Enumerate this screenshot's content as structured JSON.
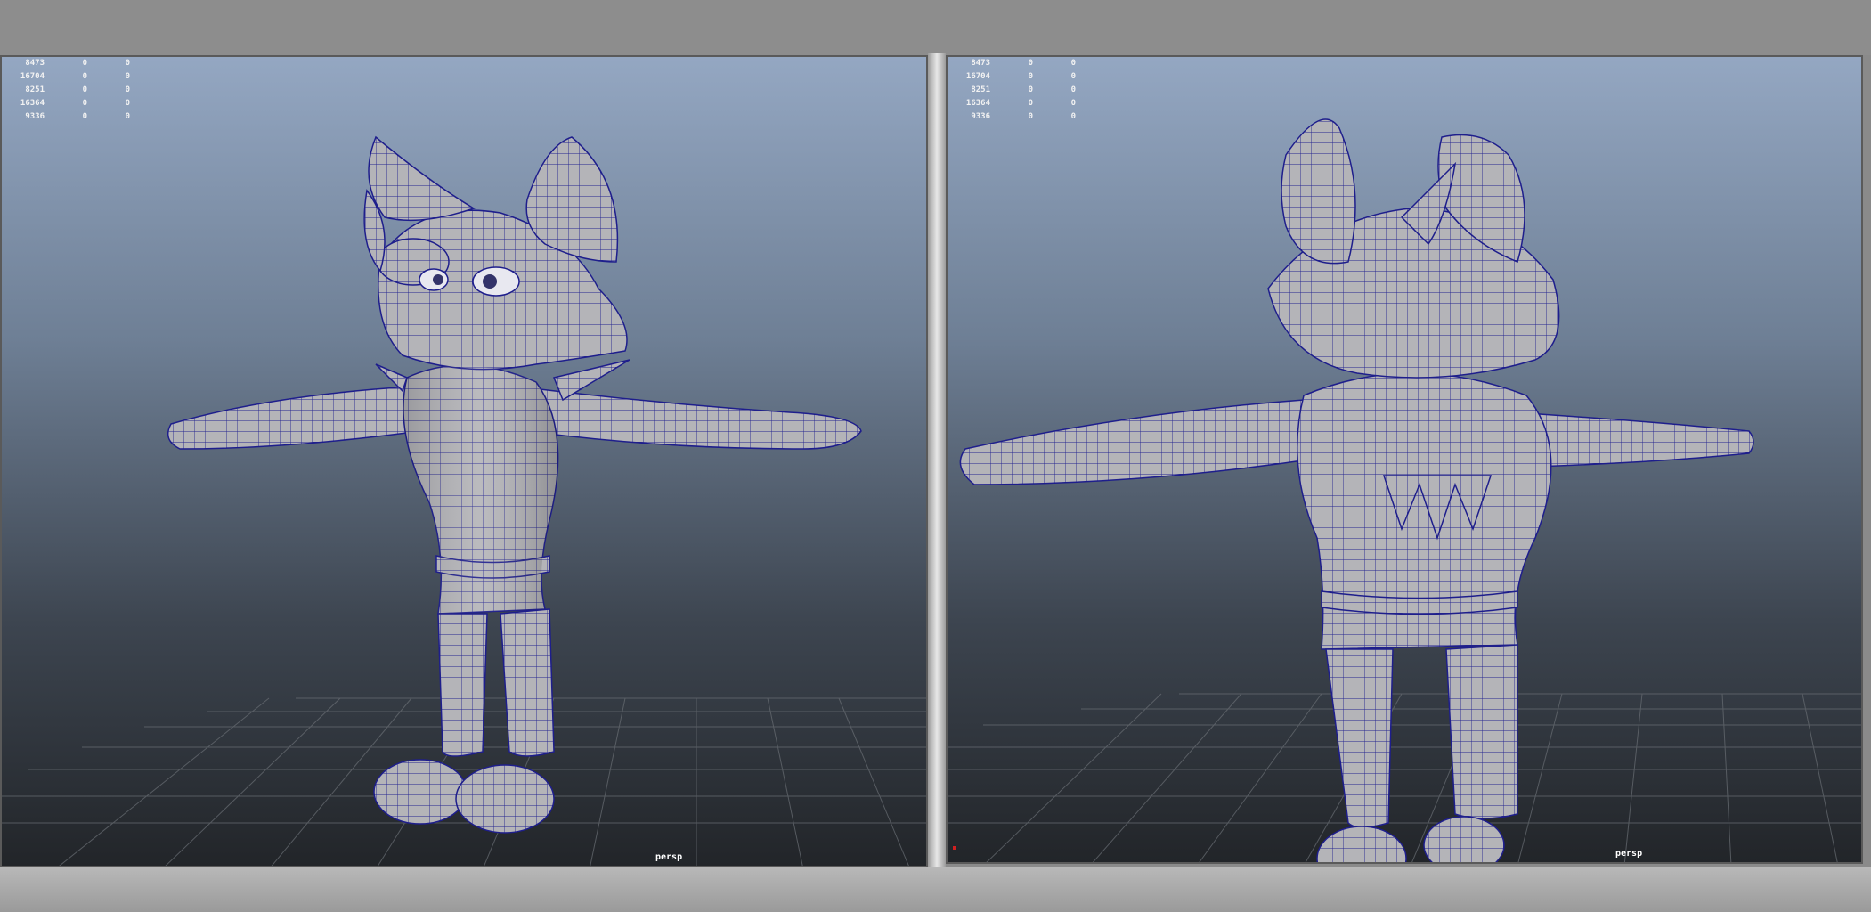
{
  "viewports": {
    "left": {
      "hud_rows": [
        [
          "8473",
          "0",
          "0"
        ],
        [
          "16704",
          "0",
          "0"
        ],
        [
          "8251",
          "0",
          "0"
        ],
        [
          "16364",
          "0",
          "0"
        ],
        [
          "9336",
          "0",
          "0"
        ]
      ],
      "camera_label": "persp"
    },
    "right": {
      "hud_rows": [
        [
          "8473",
          "0",
          "0"
        ],
        [
          "16704",
          "0",
          "0"
        ],
        [
          "8251",
          "0",
          "0"
        ],
        [
          "16364",
          "0",
          "0"
        ],
        [
          "9336",
          "0",
          "0"
        ]
      ],
      "camera_label": "persp"
    }
  },
  "colors": {
    "wireframe": "#1e1e8c",
    "mesh_fill": "#b4b4b8",
    "grid": "#6a6f75"
  }
}
